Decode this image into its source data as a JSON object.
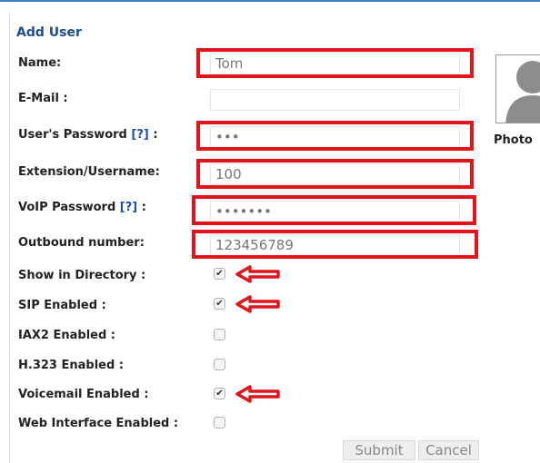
{
  "form": {
    "title": "Add User",
    "fields": {
      "name": {
        "label": "Name:",
        "value": "Tom"
      },
      "email": {
        "label": "E-Mail :",
        "value": ""
      },
      "user_password": {
        "label": "User's Password",
        "help": "[?]",
        "suffix": ":",
        "value": "•••"
      },
      "extension": {
        "label": "Extension/Username:",
        "value": "100"
      },
      "voip_password": {
        "label": "VoIP Password",
        "help": "[?]",
        "suffix": ":",
        "value": "•••••••"
      },
      "outbound": {
        "label": "Outbound number:",
        "value": "123456789"
      }
    },
    "checkboxes": {
      "directory": {
        "label": "Show in Directory :",
        "checked": true
      },
      "sip": {
        "label": "SIP Enabled :",
        "checked": true
      },
      "iax2": {
        "label": "IAX2 Enabled :",
        "checked": false
      },
      "h323": {
        "label": "H.323 Enabled :",
        "checked": false
      },
      "voicemail": {
        "label": "Voicemail Enabled :",
        "checked": true
      },
      "web": {
        "label": "Web Interface Enabled :",
        "checked": false
      }
    },
    "photo_label": "Photo",
    "submit_label": "Submit",
    "cancel_label": "Cancel"
  },
  "colors": {
    "highlight": "#e3131b",
    "title": "#1f4e8f",
    "help": "#1a4fa8"
  },
  "icons": {
    "highlight_arrow": "arrow-left-icon",
    "avatar": "user-silhouette-icon"
  }
}
